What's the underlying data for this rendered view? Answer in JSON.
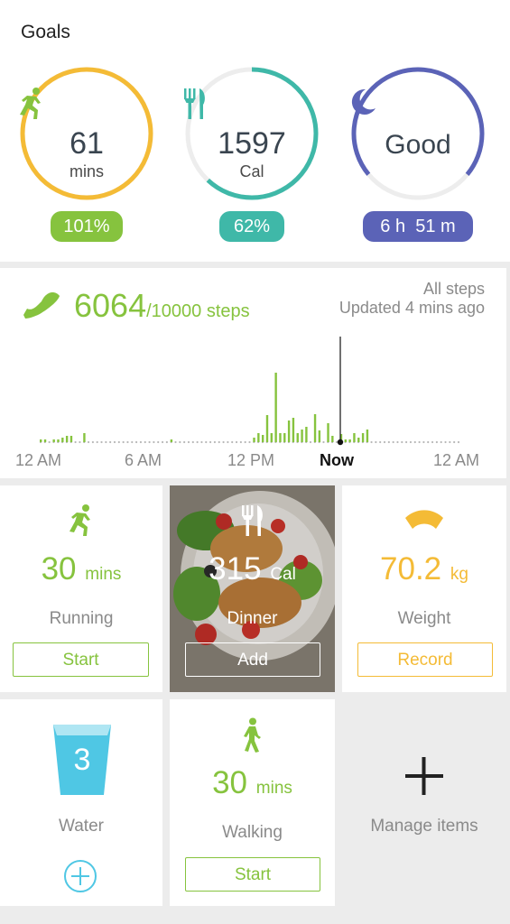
{
  "goals": {
    "title": "Goals",
    "activity": {
      "value": "61",
      "unit": "mins",
      "percent": "101%",
      "progress": 1.0,
      "color": "#f4bb36",
      "pill_color": "#86c33e",
      "icon": "running-icon"
    },
    "calories": {
      "value": "1597",
      "unit": "Cal",
      "percent": "62%",
      "progress": 0.62,
      "color": "#3fb8a8",
      "pill_color": "#3fb8a8",
      "icon": "fork-knife-icon"
    },
    "sleep": {
      "value": "Good",
      "duration": "6 h  51 m",
      "progress": 0.72,
      "color": "#5b63b7",
      "pill_color": "#5b63b7",
      "icon": "moon-icon"
    }
  },
  "steps": {
    "count": "6064",
    "goal": "/10000 steps",
    "filter": "All steps",
    "updated": "Updated 4 mins ago",
    "axis_labels": [
      "12 AM",
      "6 AM",
      "12 PM",
      "Now",
      "12 AM"
    ],
    "color": "#86c33e"
  },
  "chart_data": {
    "type": "bar",
    "title": "",
    "xlabel": "",
    "ylabel": "",
    "x_ticks": [
      "12 AM",
      "6 AM",
      "12 PM",
      "Now",
      "12 AM"
    ],
    "series": [
      {
        "values": [
          0.03,
          0.03,
          0,
          0.03,
          0.03,
          0.05,
          0.07,
          0.07,
          0,
          0,
          0.1,
          0,
          0,
          0,
          0,
          0,
          0,
          0,
          0,
          0,
          0,
          0,
          0,
          0,
          0,
          0,
          0,
          0,
          0,
          0,
          0.03,
          0,
          0,
          0,
          0,
          0,
          0,
          0,
          0,
          0,
          0,
          0,
          0,
          0,
          0,
          0,
          0,
          0,
          0,
          0.05,
          0.1,
          0.08,
          0.3,
          0.1,
          0.77,
          0.1,
          0.1,
          0.24,
          0.27,
          0.1,
          0.14,
          0.17,
          0,
          0.31,
          0.13,
          0,
          0.21,
          0.07,
          0,
          0.09,
          0.03,
          0.03,
          0.1,
          0.05,
          0.1,
          0.14
        ]
      }
    ]
  },
  "tiles": {
    "running": {
      "value": "30",
      "unit": "mins",
      "label": "Running",
      "button": "Start",
      "icon": "running-icon"
    },
    "dinner": {
      "value": "315",
      "unit": "Cal",
      "label": "Dinner",
      "button": "Add",
      "icon": "fork-knife-icon"
    },
    "weight": {
      "value": "70.2",
      "unit": "kg",
      "label": "Weight",
      "button": "Record",
      "icon": "scale-icon",
      "color": "#f4bb36"
    },
    "water": {
      "value": "3",
      "label": "Water",
      "icon": "cup-icon",
      "color": "#4fc7e4"
    },
    "walking": {
      "value": "30",
      "unit": "mins",
      "label": "Walking",
      "button": "Start",
      "icon": "walking-icon"
    },
    "manage": {
      "label": "Manage items",
      "icon": "plus-icon"
    }
  }
}
